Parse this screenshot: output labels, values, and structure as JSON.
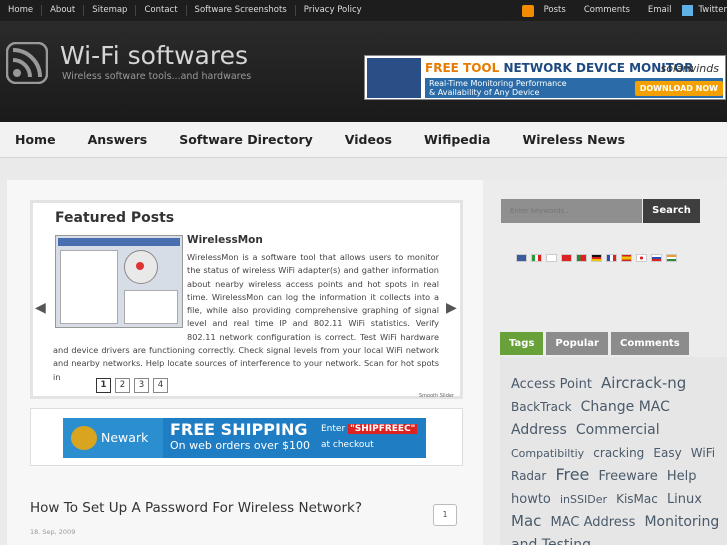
{
  "topbar": {
    "links": [
      "Home",
      "About",
      "Sitemap",
      "Contact",
      "Software Screenshots",
      "Privacy Policy"
    ],
    "right": [
      "Posts",
      "Comments",
      "Email",
      "Twitter"
    ]
  },
  "header": {
    "title": "Wi-Fi softwares",
    "tagline": "Wireless software tools...and hardwares"
  },
  "banner": {
    "free_tool": "FREE TOOL",
    "product": "NETWORK DEVICE MONITOR",
    "brand": "solarwinds",
    "line1": "Real-Time Monitoring Performance",
    "line2": "& Availability of Any Device",
    "cta": "DOWNLOAD NOW"
  },
  "nav": [
    "Home",
    "Answers",
    "Software Directory",
    "Videos",
    "Wifipedia",
    "Wireless News"
  ],
  "featured": {
    "heading": "Featured Posts",
    "item_title": "WirelessMon",
    "text": "WirelessMon is a software tool that allows users to monitor the status of wireless WiFi adapter(s) and gather information about nearby wireless access points and hot spots in real time. WirelessMon can log the information it collects into a file, while also providing comprehensive graphing of signal level and real time IP and 802.11 WiFi statistics. Verify 802.11 network configuration is correct. Test WiFi hardware and device drivers are functioning correctly. Check signal levels from your local WiFi network and nearby networks. Help locate sources of interference to your network. Scan for hot spots in",
    "pages": [
      "1",
      "2",
      "3",
      "4"
    ],
    "credit": "Smooth Slider"
  },
  "ad2": {
    "brand": "Newark",
    "headline": "FREE SHIPPING",
    "sub": "On web orders over $100",
    "enter": "Enter",
    "code": "\"SHIPFREEC\"",
    "checkout": "at checkout"
  },
  "post": {
    "title": "How To Set Up A Password For Wireless Network?",
    "date": "18. Sep, 2009",
    "comments": "1"
  },
  "sidebar": {
    "search_placeholder": "Enter keywords...",
    "search_button": "Search",
    "tabs": [
      "Tags",
      "Popular",
      "Comments"
    ],
    "tags": [
      {
        "t": "Access Point",
        "s": 13
      },
      {
        "t": "Aircrack-ng",
        "s": 15
      },
      {
        "t": "BackTrack",
        "s": 12
      },
      {
        "t": "Change MAC",
        "s": 14
      },
      {
        "t": "Address",
        "s": 14
      },
      {
        "t": "Commercial",
        "s": 14
      },
      {
        "t": "Compatibiltiy",
        "s": 11
      },
      {
        "t": "cracking",
        "s": 12
      },
      {
        "t": "Easy",
        "s": 12
      },
      {
        "t": "WiFi Radar",
        "s": 12
      },
      {
        "t": "Free",
        "s": 16
      },
      {
        "t": "Freeware",
        "s": 13
      },
      {
        "t": "Help",
        "s": 13
      },
      {
        "t": "howto",
        "s": 13
      },
      {
        "t": "inSSIDer",
        "s": 11
      },
      {
        "t": "KisMac",
        "s": 12
      },
      {
        "t": "Linux",
        "s": 13
      },
      {
        "t": "Mac",
        "s": 15
      },
      {
        "t": "MAC Address",
        "s": 13
      },
      {
        "t": "Monitoring and Testing",
        "s": 14
      }
    ]
  }
}
